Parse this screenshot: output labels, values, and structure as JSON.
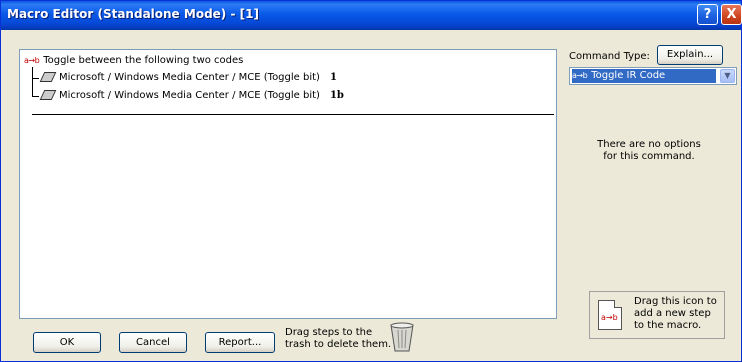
{
  "window": {
    "title": "Macro Editor (Standalone Mode) - [1]",
    "help_label": "?",
    "close_label": "X"
  },
  "tree": {
    "root": {
      "icon": "a→b",
      "label": "Toggle between the following two codes"
    },
    "children": [
      {
        "label": "Microsoft / Windows Media Center / MCE (Toggle bit)",
        "code": "1"
      },
      {
        "label": "Microsoft / Windows Media Center / MCE (Toggle bit)",
        "code": "1b"
      }
    ]
  },
  "buttons": {
    "ok": "OK",
    "cancel": "Cancel",
    "report": "Report...",
    "explain": "Explain..."
  },
  "trash_note": {
    "line1": "Drag steps to the",
    "line2": "trash to delete them."
  },
  "command": {
    "label": "Command Type:",
    "selected_icon": "a→b",
    "selected": "Toggle IR Code",
    "dropdown_glyph": "▼"
  },
  "options": {
    "line1": "There are no options",
    "line2": "for this command."
  },
  "drag_hint": {
    "icon": "a→b",
    "line1": "Drag this icon to",
    "line2": "add a new step",
    "line3": "to the macro."
  },
  "colors": {
    "title_bar": "#0a5ae8",
    "selection": "#316ac5",
    "icon_red": "#c00000"
  }
}
